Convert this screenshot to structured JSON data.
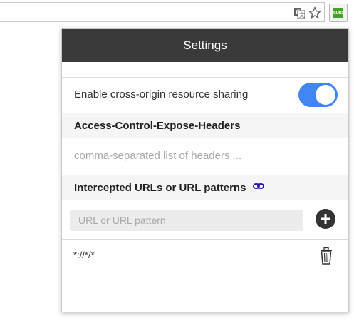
{
  "toolbar": {
    "translate_icon": "translate-icon",
    "star_icon": "bookmark-star-icon",
    "extension_badge": "CORS",
    "extension_badge_color": "#43a22c"
  },
  "popup": {
    "title": "Settings",
    "header_color": "#3a3a3a",
    "cors_toggle": {
      "label": "Enable cross-origin resource sharing",
      "enabled": true,
      "color": "#4285f4"
    },
    "expose_headers": {
      "title": "Access-Control-Expose-Headers",
      "placeholder": "comma-separated list of headers ..."
    },
    "intercepted": {
      "title": "Intercepted URLs or URL patterns",
      "title_icon": "link-icon",
      "input_placeholder": "URL or URL pattern",
      "add_icon": "add-circle-icon",
      "entries": [
        {
          "pattern": "*://*/*",
          "delete_icon": "trash-icon"
        }
      ]
    }
  }
}
